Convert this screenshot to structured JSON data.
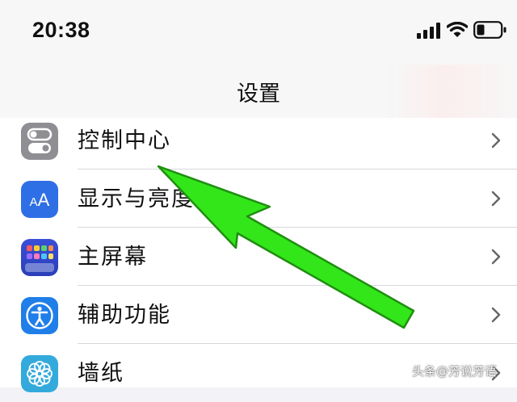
{
  "status_bar": {
    "time": "20:38",
    "icons": [
      "signal-icon",
      "wifi-icon",
      "battery-icon"
    ]
  },
  "nav": {
    "title": "设置"
  },
  "settings": {
    "items": [
      {
        "label": "控制中心",
        "icon": "control-center-icon",
        "icon_color": "#8e8e93"
      },
      {
        "label": "显示与亮度",
        "icon": "display-brightness-icon",
        "icon_color": "#2f6fe6"
      },
      {
        "label": "主屏幕",
        "icon": "home-screen-icon",
        "icon_color": "#2a3fb8"
      },
      {
        "label": "辅助功能",
        "icon": "accessibility-icon",
        "icon_color": "#1f7ee8"
      },
      {
        "label": "墙纸",
        "icon": "wallpaper-icon",
        "icon_color": "#34aadc"
      }
    ]
  },
  "annotation": {
    "arrow_color": "#33e61a",
    "arrow_outline": "#1f8f10"
  },
  "watermark": {
    "text": "头条@芳说芳语"
  }
}
